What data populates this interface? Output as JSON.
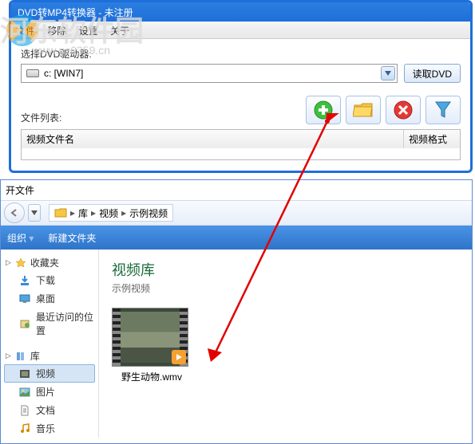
{
  "watermark": {
    "text": "河东软件园",
    "url": "www.pc0359.cn"
  },
  "topWindow": {
    "title": "DVD转MP4转换器 - 未注册",
    "menu": {
      "file": "文件",
      "remove": "移除",
      "settings": "设置",
      "about": "关于"
    },
    "driveLabel": "选择DVD驱动器:",
    "driveValue": "c: [WIN7]",
    "readDvd": "读取DVD",
    "fileListLabel": "文件列表:",
    "columns": {
      "name": "视频文件名",
      "format": "视频格式"
    },
    "iconButtons": {
      "add": "add",
      "folder": "folder",
      "remove": "remove",
      "filter": "filter"
    }
  },
  "fileDialog": {
    "title": "开文件",
    "breadcrumb": {
      "library": "库",
      "videos": "视频",
      "sample": "示例视频"
    },
    "commands": {
      "organize": "组织",
      "newFolder": "新建文件夹"
    },
    "sidebar": {
      "favorites": "收藏夹",
      "downloads": "下载",
      "desktop": "桌面",
      "recent": "最近访问的位置",
      "libraries": "库",
      "videos": "视频",
      "pictures": "图片",
      "documents": "文档",
      "music": "音乐"
    },
    "content": {
      "libTitle": "视频库",
      "libSub": "示例视频",
      "file": "野生动物.wmv"
    }
  }
}
